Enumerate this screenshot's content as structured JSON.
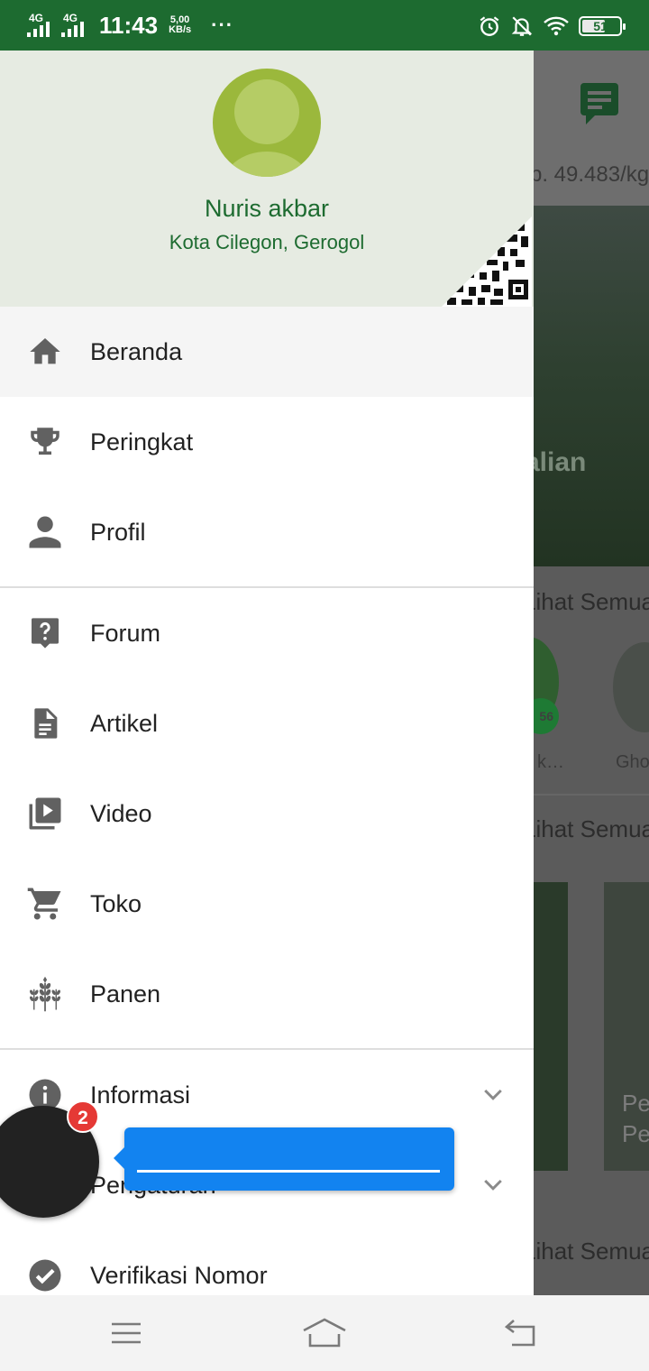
{
  "status_bar": {
    "network_1": "4G",
    "network_2": "4G",
    "time": "11:43",
    "speed_value": "5,00",
    "speed_unit": "KB/s",
    "more": "···",
    "battery": "51",
    "icons": [
      "alarm-icon",
      "notifications-off-icon",
      "wifi-icon",
      "battery-icon"
    ],
    "background_color": "#1d6b30"
  },
  "background_app": {
    "price": "p. 49.483/kg",
    "banner_text": "alian",
    "see_all_1": "Lihat Semua",
    "see_all_2": "Lihat Semua",
    "see_all_3": "Lihat Semua",
    "badge_value": "56",
    "user_label_1": "k…",
    "user_label_2": "Gho",
    "card_text_1": "Pe",
    "card_text_2": "Pe"
  },
  "drawer": {
    "header": {
      "user_name": "Nuris akbar",
      "user_location": "Kota Cilegon, Gerogol",
      "background_color": "#e6ebe2",
      "accent_color": "#1d6b30"
    },
    "items": [
      {
        "label": "Beranda",
        "icon": "home-icon",
        "active": true
      },
      {
        "label": "Peringkat",
        "icon": "trophy-icon"
      },
      {
        "label": "Profil",
        "icon": "person-icon"
      },
      {
        "label": "Forum",
        "icon": "help-bubble-icon"
      },
      {
        "label": "Artikel",
        "icon": "document-icon"
      },
      {
        "label": "Video",
        "icon": "video-library-icon"
      },
      {
        "label": "Toko",
        "icon": "cart-icon"
      },
      {
        "label": "Panen",
        "icon": "wheat-icon"
      },
      {
        "label": "Informasi",
        "icon": "info-icon",
        "expandable": true
      },
      {
        "label": "Pengaturan",
        "icon": "settings-icon",
        "expandable": true
      },
      {
        "label": "Verifikasi Nomor",
        "icon": "check-circle-icon"
      }
    ]
  },
  "floating_bubble": {
    "badge_count": "2",
    "tooltip_color": "#1283f0"
  },
  "nav_bar": {
    "buttons": [
      "menu-icon",
      "home-icon",
      "back-icon"
    ]
  }
}
